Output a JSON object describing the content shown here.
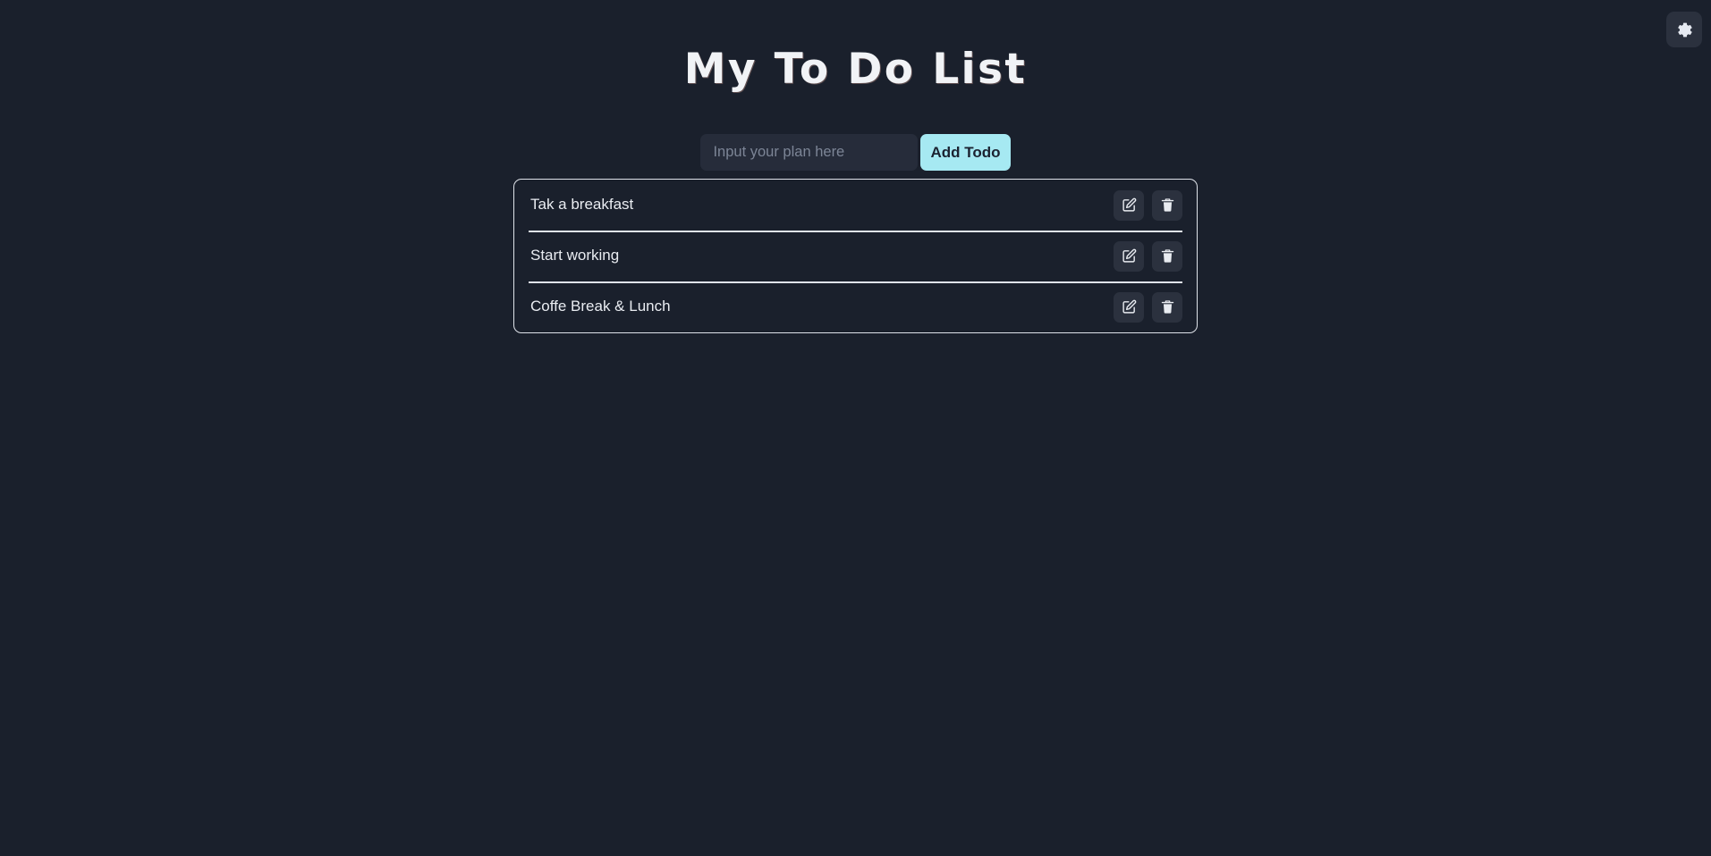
{
  "app": {
    "title": "My To Do List",
    "background_color": "#1a202c",
    "accent_color": "#a6e9f2",
    "border_color": "#dfe3ea",
    "surface_color": "#2b313e"
  },
  "settings": {
    "icon": "gear-icon",
    "label": "Settings"
  },
  "add_form": {
    "input_value": "",
    "input_placeholder": "Input your plan here",
    "submit_label": "Add Todo"
  },
  "todos": [
    {
      "text": "Tak a breakfast",
      "edit_icon": "pen-to-square-icon",
      "delete_icon": "trash-icon"
    },
    {
      "text": "Start working",
      "edit_icon": "pen-to-square-icon",
      "delete_icon": "trash-icon"
    },
    {
      "text": "Coffe Break & Lunch",
      "edit_icon": "pen-to-square-icon",
      "delete_icon": "trash-icon"
    }
  ]
}
